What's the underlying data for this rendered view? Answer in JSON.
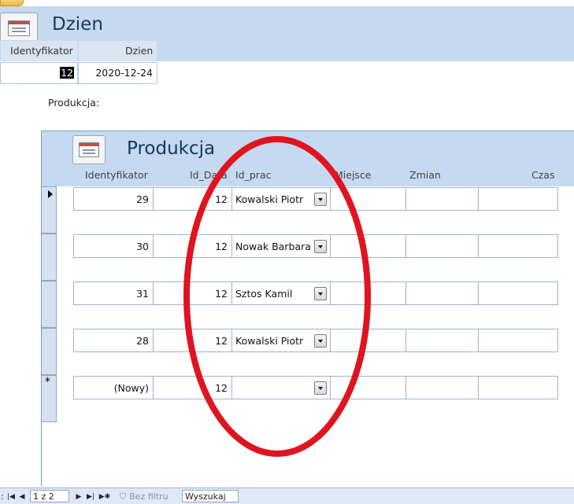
{
  "form": {
    "title": "Dzien",
    "header": {
      "id_label": "Identyfikator",
      "day_label": "Dzien"
    },
    "record": {
      "id": "12",
      "day": "2020-12-24"
    },
    "subform_label": "Produkcja:"
  },
  "subform": {
    "title": "Produkcja",
    "columns": [
      "Identyfikator",
      "Id_Data",
      "Id_prac",
      "Miejsce",
      "Zmian",
      "Czas"
    ],
    "rows": [
      {
        "id": "29",
        "id_data": "12",
        "id_prac": "Kowalski Piotr",
        "miejsce": "",
        "zmian": "",
        "czas": ""
      },
      {
        "id": "30",
        "id_data": "12",
        "id_prac": "Nowak Barbara",
        "miejsce": "",
        "zmian": "",
        "czas": ""
      },
      {
        "id": "31",
        "id_data": "12",
        "id_prac": "Sztos Kamil",
        "miejsce": "",
        "zmian": "",
        "czas": ""
      },
      {
        "id": "28",
        "id_data": "12",
        "id_prac": "Kowalski Piotr",
        "miejsce": "",
        "zmian": "",
        "czas": ""
      }
    ],
    "new_row": {
      "id": "(Nowy)",
      "id_data": "12",
      "id_prac": ""
    },
    "new_row_marker": "*"
  },
  "navigation": {
    "prefix": ":",
    "position": "1 z 2",
    "filter_label": "Bez filtru",
    "search_placeholder": "Wyszukaj"
  },
  "annotation": {
    "color": "#e0141e"
  }
}
